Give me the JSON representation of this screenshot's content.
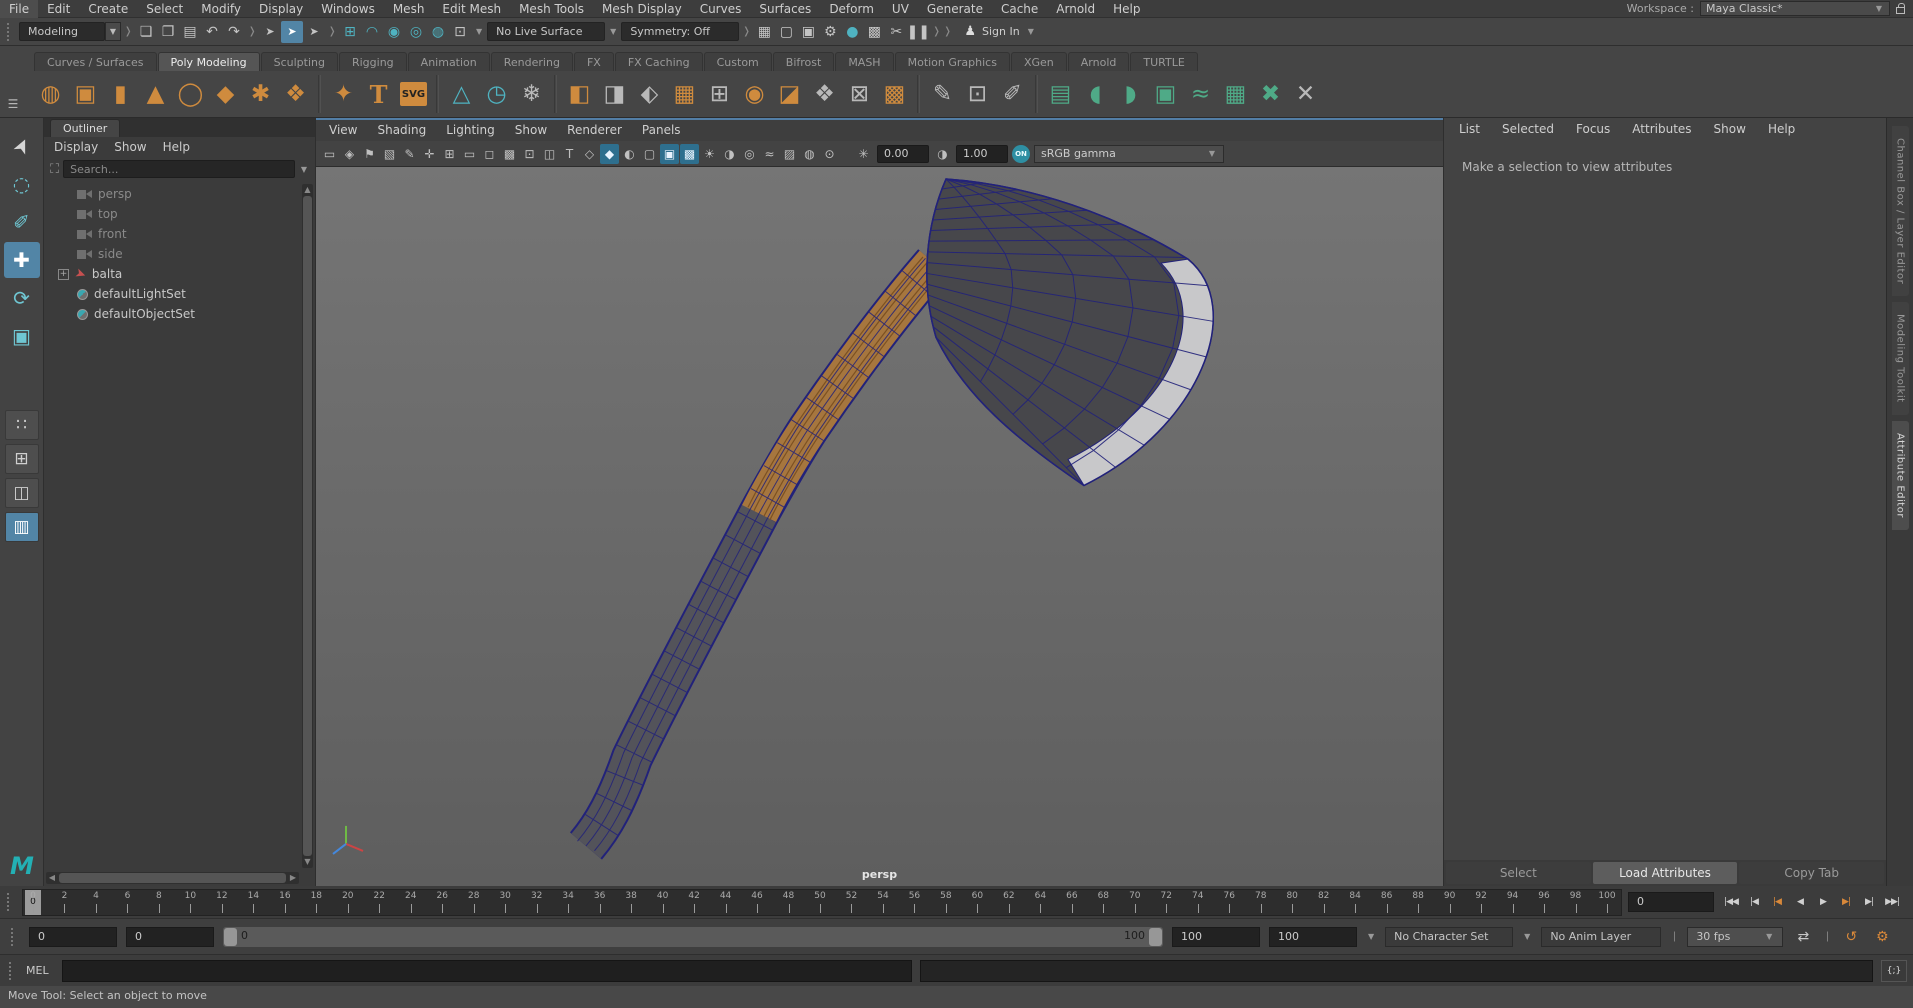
{
  "window": {
    "workspace_label": "Workspace :",
    "workspace_value": "Maya Classic*"
  },
  "menu_bar": {
    "items": [
      "File",
      "Edit",
      "Create",
      "Select",
      "Modify",
      "Display",
      "Windows",
      "Mesh",
      "Edit Mesh",
      "Mesh Tools",
      "Mesh Display",
      "Curves",
      "Surfaces",
      "Deform",
      "UV",
      "Generate",
      "Cache",
      "Arnold",
      "Help"
    ]
  },
  "status_line": {
    "mode_selector": "Modeling",
    "file_icons": [
      {
        "name": "new-scene-icon",
        "glyph": "❏"
      },
      {
        "name": "open-scene-icon",
        "glyph": "❐"
      },
      {
        "name": "save-scene-icon",
        "glyph": "▤"
      },
      {
        "name": "undo-icon",
        "glyph": "↶"
      },
      {
        "name": "redo-icon",
        "glyph": "↷"
      }
    ],
    "selection_icons": [
      {
        "name": "select-by-hierarchy-icon",
        "glyph": "➤"
      },
      {
        "name": "select-by-object-icon",
        "glyph": "➤",
        "active": true
      },
      {
        "name": "select-by-component-icon",
        "glyph": "➤"
      }
    ],
    "snap_icons": [
      {
        "name": "snap-to-grid-icon",
        "glyph": "⊞",
        "teal": true
      },
      {
        "name": "snap-to-curve-icon",
        "glyph": "◠",
        "teal": true
      },
      {
        "name": "snap-to-point-icon",
        "glyph": "◉",
        "teal": true
      },
      {
        "name": "snap-to-projected-center-icon",
        "glyph": "◎",
        "teal": true
      },
      {
        "name": "make-object-live-icon",
        "glyph": "◍",
        "teal": true
      },
      {
        "name": "snap-to-view-plane-icon",
        "glyph": "⊡"
      }
    ],
    "render_icons": [
      {
        "name": "render-view-icon",
        "glyph": "▦"
      },
      {
        "name": "render-current-frame-icon",
        "glyph": "▢"
      },
      {
        "name": "ipr-render-icon",
        "glyph": "▣"
      },
      {
        "name": "render-settings-icon",
        "glyph": "⚙"
      },
      {
        "name": "hypershade-icon",
        "glyph": "●",
        "teal": true
      },
      {
        "name": "texture-view-icon",
        "glyph": "▩"
      },
      {
        "name": "paint-effects-icon",
        "glyph": "✂"
      },
      {
        "name": "pause-viewport-icon",
        "glyph": "❚❚"
      }
    ],
    "live_surface": "No Live Surface",
    "symmetry": "Symmetry: Off",
    "sign_in": "Sign In"
  },
  "shelf": {
    "tabs": [
      {
        "label": "Curves / Surfaces"
      },
      {
        "label": "Poly Modeling",
        "active": true
      },
      {
        "label": "Sculpting"
      },
      {
        "label": "Rigging"
      },
      {
        "label": "Animation"
      },
      {
        "label": "Rendering"
      },
      {
        "label": "FX"
      },
      {
        "label": "FX Caching"
      },
      {
        "label": "Custom"
      },
      {
        "label": "Bifrost"
      },
      {
        "label": "MASH"
      },
      {
        "label": "Motion Graphics"
      },
      {
        "label": "XGen"
      },
      {
        "label": "Arnold"
      },
      {
        "label": "TURTLE"
      }
    ],
    "icons": [
      {
        "name": "poly-sphere-icon",
        "glyph": "◍",
        "color": "o"
      },
      {
        "name": "poly-cube-icon",
        "glyph": "▣",
        "color": "o"
      },
      {
        "name": "poly-cylinder-icon",
        "glyph": "▮",
        "color": "o"
      },
      {
        "name": "poly-cone-icon",
        "glyph": "▲",
        "color": "o"
      },
      {
        "name": "poly-torus-icon",
        "glyph": "◯",
        "color": "o"
      },
      {
        "name": "poly-plane-icon",
        "glyph": "◆",
        "color": "o"
      },
      {
        "name": "poly-disc-icon",
        "glyph": "✱",
        "color": "o"
      },
      {
        "name": "platonic-solid-icon",
        "glyph": "❖",
        "color": "o"
      },
      {
        "sep": true
      },
      {
        "name": "super-shape-icon",
        "glyph": "✦",
        "color": "o"
      },
      {
        "name": "type-tool-icon",
        "glyph": "T",
        "color": "o",
        "typeT": true
      },
      {
        "name": "svg-tool-icon",
        "glyph": "SVG",
        "badge": true
      },
      {
        "sep": true
      },
      {
        "name": "live-surface-icon",
        "glyph": "△",
        "color": "t"
      },
      {
        "name": "keyframe-clock-icon",
        "glyph": "◷",
        "color": "t"
      },
      {
        "name": "zero-transforms-icon",
        "glyph": "❄",
        "color": "g"
      },
      {
        "sep": true
      },
      {
        "name": "combine-icon",
        "glyph": "◧",
        "color": "o"
      },
      {
        "name": "separate-icon",
        "glyph": "◨",
        "color": "g"
      },
      {
        "name": "smooth-icon",
        "glyph": "⬖",
        "color": "g"
      },
      {
        "name": "mirror-icon",
        "glyph": "▦",
        "color": "o"
      },
      {
        "name": "grid-fill-icon",
        "glyph": "⊞",
        "color": "g"
      },
      {
        "name": "bridge-icon",
        "glyph": "◉",
        "color": "o"
      },
      {
        "name": "extrude-icon",
        "glyph": "◪",
        "color": "o"
      },
      {
        "name": "bevel-icon",
        "glyph": "❖",
        "color": "g"
      },
      {
        "name": "boolean-icon",
        "glyph": "⊠",
        "color": "g"
      },
      {
        "name": "sphere-morph-icon",
        "glyph": "▩",
        "color": "o"
      },
      {
        "sep": true
      },
      {
        "name": "multi-cut-icon",
        "glyph": "✎",
        "color": "g"
      },
      {
        "name": "insert-edge-loop-icon",
        "glyph": "⊡",
        "color": "g"
      },
      {
        "name": "quad-draw-icon",
        "glyph": "✐",
        "color": "g"
      },
      {
        "sep": true
      },
      {
        "name": "uv-planar-icon",
        "glyph": "▤",
        "color": "n"
      },
      {
        "name": "uv-cylindrical-icon",
        "glyph": "◖",
        "color": "n"
      },
      {
        "name": "uv-spherical-icon",
        "glyph": "◗",
        "color": "n"
      },
      {
        "name": "uv-automatic-icon",
        "glyph": "▣",
        "color": "n"
      },
      {
        "name": "uv-contour-stretch-icon",
        "glyph": "≈",
        "color": "n"
      },
      {
        "name": "uv-layout-icon",
        "glyph": "▦",
        "color": "n"
      },
      {
        "name": "uv-cut-sew-icon",
        "glyph": "✖",
        "color": "n"
      },
      {
        "name": "uv-editor-icon",
        "glyph": "✕",
        "color": "g"
      }
    ]
  },
  "toolbox": {
    "tools": [
      {
        "name": "select-tool-button",
        "glyph": "➤",
        "rot": true
      },
      {
        "name": "lasso-tool-button",
        "glyph": "◌",
        "teal": true
      },
      {
        "name": "paint-select-tool-button",
        "glyph": "✐",
        "teal": true
      },
      {
        "name": "move-tool-button",
        "glyph": "✚",
        "active": true
      },
      {
        "name": "rotate-tool-button",
        "glyph": "⟳",
        "teal": true
      },
      {
        "name": "scale-tool-button",
        "glyph": "▣",
        "teal": true
      }
    ],
    "layouts": [
      {
        "name": "layout-single-pane-button",
        "glyph": "∷"
      },
      {
        "name": "layout-four-view-button",
        "glyph": "⊞"
      },
      {
        "name": "layout-two-pane-button",
        "glyph": "◫"
      },
      {
        "name": "layout-outliner-persp-button",
        "glyph": "▥",
        "active": true
      }
    ]
  },
  "outliner": {
    "tab": "Outliner",
    "menus": [
      "Display",
      "Show",
      "Help"
    ],
    "search_placeholder": "Search...",
    "items": [
      {
        "label": "persp",
        "kind": "camera",
        "dim": true
      },
      {
        "label": "top",
        "kind": "camera",
        "dim": true
      },
      {
        "label": "front",
        "kind": "camera",
        "dim": true
      },
      {
        "label": "side",
        "kind": "camera",
        "dim": true
      },
      {
        "label": "balta",
        "kind": "mesh",
        "expandable": true
      },
      {
        "label": "defaultLightSet",
        "kind": "set"
      },
      {
        "label": "defaultObjectSet",
        "kind": "set"
      }
    ]
  },
  "viewport": {
    "menus": [
      "View",
      "Shading",
      "Lighting",
      "Show",
      "Renderer",
      "Panels"
    ],
    "icons": [
      {
        "name": "camera-select-icon",
        "glyph": "▭"
      },
      {
        "name": "camera-lock-icon",
        "glyph": "◈"
      },
      {
        "name": "camera-bookmark-icon",
        "glyph": "⚑"
      },
      {
        "name": "image-plane-icon",
        "glyph": "▧"
      },
      {
        "name": "grease-pencil-icon",
        "glyph": "✎"
      },
      {
        "name": "pan-zoom-icon",
        "glyph": "✛"
      },
      {
        "name": "grid-toggle-icon",
        "glyph": "⊞"
      },
      {
        "name": "film-gate-icon",
        "glyph": "▭"
      },
      {
        "name": "resolution-gate-icon",
        "glyph": "◻"
      },
      {
        "name": "gate-mask-icon",
        "glyph": "▩"
      },
      {
        "name": "field-chart-icon",
        "glyph": "⊡"
      },
      {
        "name": "safe-action-icon",
        "glyph": "◫"
      },
      {
        "name": "safe-title-icon",
        "glyph": "T"
      },
      {
        "name": "wireframe-icon",
        "glyph": "◇"
      },
      {
        "name": "smooth-shade-icon",
        "glyph": "◆",
        "active": true
      },
      {
        "name": "flat-shade-icon",
        "glyph": "◐"
      },
      {
        "name": "bounding-box-icon",
        "glyph": "▢"
      },
      {
        "name": "textured-icon",
        "glyph": "▣",
        "active": true
      },
      {
        "name": "wireframe-on-shaded-icon",
        "glyph": "▩",
        "active": true
      },
      {
        "name": "lighting-toggle-icon",
        "glyph": "☀"
      },
      {
        "name": "shadows-icon",
        "glyph": "◑"
      },
      {
        "name": "ambient-occlusion-icon",
        "glyph": "◎"
      },
      {
        "name": "motion-blur-icon",
        "glyph": "≈"
      },
      {
        "name": "anti-alias-icon",
        "glyph": "▨"
      },
      {
        "name": "xray-icon",
        "glyph": "◍"
      },
      {
        "name": "isolate-select-icon",
        "glyph": "⊙"
      }
    ],
    "exposure_value": "0.00",
    "gamma_value": "1.00",
    "on_badge": "ON",
    "color_mgmt": "sRGB gamma",
    "camera_label": "persp",
    "object_name": "balta"
  },
  "attribute_editor": {
    "menus": [
      "List",
      "Selected",
      "Focus",
      "Attributes",
      "Show",
      "Help"
    ],
    "message": "Make a selection to view attributes",
    "select_button": "Select",
    "load_button": "Load Attributes",
    "copy_button": "Copy Tab"
  },
  "side_tabs": [
    {
      "label": "Channel Box / Layer Editor"
    },
    {
      "label": "Modeling Toolkit"
    },
    {
      "label": "Attribute Editor",
      "active": true
    }
  ],
  "timeline": {
    "tick_labels": [
      0,
      2,
      4,
      6,
      8,
      10,
      12,
      14,
      16,
      18,
      20,
      22,
      24,
      26,
      28,
      30,
      32,
      34,
      36,
      38,
      40,
      42,
      44,
      46,
      48,
      50,
      52,
      54,
      56,
      58,
      60,
      62,
      64,
      66,
      68,
      70,
      72,
      74,
      76,
      78,
      80,
      82,
      84,
      86,
      88,
      90,
      92,
      94,
      96,
      98,
      100
    ],
    "current_frame": "0",
    "current_time_field": "0"
  },
  "playback": [
    {
      "name": "go-to-start-button",
      "glyph": "|◀◀"
    },
    {
      "name": "step-back-frame-button",
      "glyph": "|◀"
    },
    {
      "name": "step-back-key-button",
      "glyph": "|◀",
      "accent": true
    },
    {
      "name": "play-backward-button",
      "glyph": "◀"
    },
    {
      "name": "play-forward-button",
      "glyph": "▶"
    },
    {
      "name": "step-forward-key-button",
      "glyph": "▶|",
      "accent": true
    },
    {
      "name": "step-forward-frame-button",
      "glyph": "▶|"
    },
    {
      "name": "go-to-end-button",
      "glyph": "▶▶|"
    }
  ],
  "range_slider": {
    "playback_start": "0",
    "anim_start": "0",
    "bar_start_label": "0",
    "bar_end_label": "100",
    "anim_end": "100",
    "playback_end": "100",
    "character_set": "No Character Set",
    "anim_layer": "No Anim Layer",
    "fps": "30 fps"
  },
  "command_line": {
    "label": "MEL",
    "script_editor_glyph": "{;}"
  },
  "help_line": {
    "text": "Move Tool: Select an object to move"
  },
  "colors": {
    "accent": "#5285a6",
    "teal": "#4fb3c1",
    "orange": "#cf8b3e",
    "green": "#4faa87",
    "wireframe": "#22227a"
  }
}
